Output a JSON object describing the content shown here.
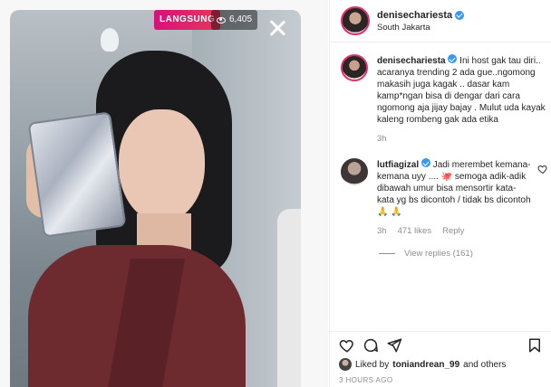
{
  "live": {
    "badge": "LANGSUNG",
    "viewer_count": "6,405"
  },
  "post": {
    "username": "denisechariesta",
    "location": "South Jakarta"
  },
  "caption": {
    "username": "denisechariesta",
    "text": "Ini host gak tau diri.. acaranya trending 2 ada gue..ngomong makasih juga kagak .. dasar kam kamp*ngan bisa di dengar dari cara ngomong aja jijay bajay . Mulut uda kayak kaleng rombeng gak ada etika",
    "time": "3h"
  },
  "comment": {
    "username": "lutfiagizal",
    "text": "Jadi merembet kemana-kemana uyy .... 🐙 semoga adik-adik dibawah umur bisa mensortir kata-kata yg bs dicontoh / tidak bs dicontoh🙏 🙏",
    "time": "3h",
    "likes": "471 likes",
    "reply": "Reply",
    "view_replies": "View replies (161)"
  },
  "footer": {
    "liked_by_prefix": "Liked by",
    "liked_by_user": "toniandrean_99",
    "liked_by_suffix": "and others",
    "timestamp": "3 HOURS AGO"
  },
  "icons": [
    "eye-icon",
    "close-icon",
    "verified-icon",
    "heart-icon",
    "comment-icon",
    "share-icon",
    "bookmark-icon"
  ],
  "colors": {
    "live_badge": "#d6127a",
    "verified": "#3897f0",
    "muted_text": "#8e8e8e"
  }
}
